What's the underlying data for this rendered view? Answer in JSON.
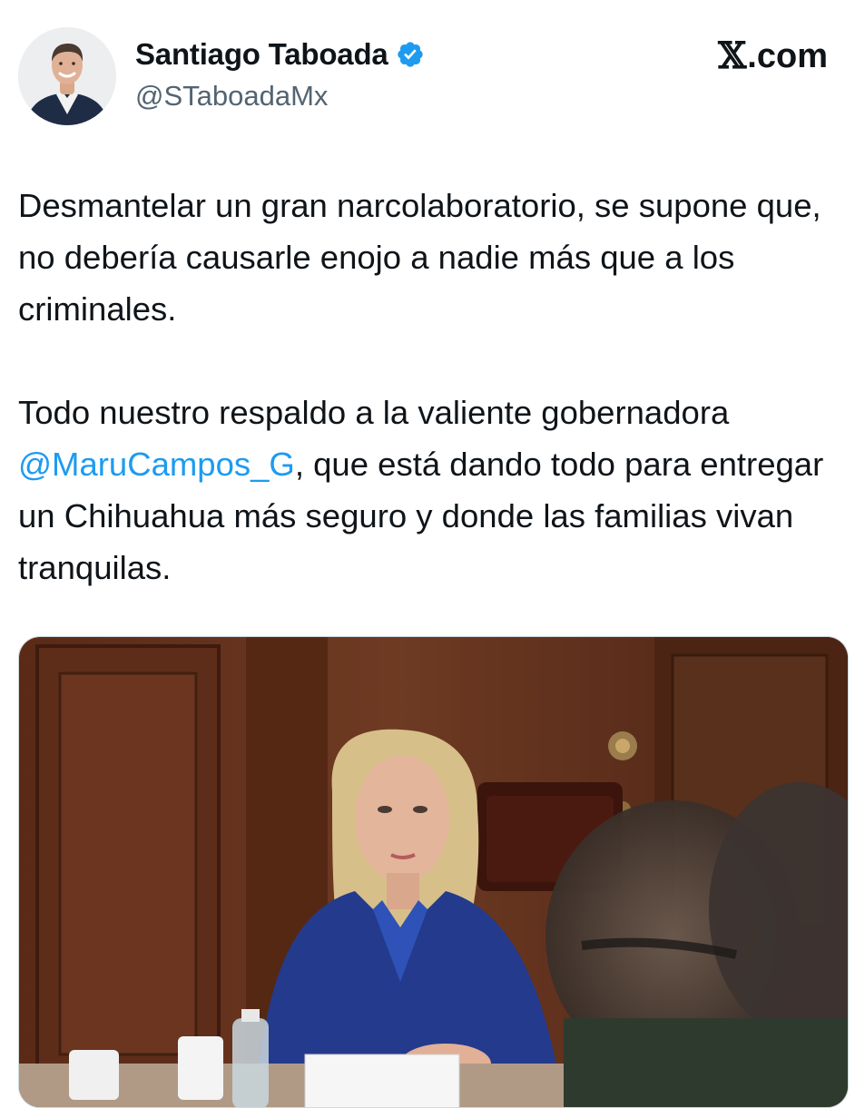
{
  "author": {
    "display_name": "Santiago Taboada",
    "handle": "@STaboadaMx",
    "verified": true,
    "avatar_icon": "avatar-photo-man-in-suit"
  },
  "brand": {
    "mark": "𝕏",
    "suffix": ".com"
  },
  "tweet": {
    "paragraph1": "Desmantelar un gran narcolaboratorio, se supone que, no debería causarle enojo a nadie más que a los criminales.",
    "paragraph2_before": "Todo nuestro respaldo a la valiente gobernadora ",
    "paragraph2_mention": "@MaruCampos_G",
    "paragraph2_after": ", que está dando todo para entregar un Chihuahua más seguro y donde las familias vivan tranquilas."
  },
  "media": {
    "description_icon": "photo-woman-at-meeting-table"
  },
  "colors": {
    "mention": "#1d9bf0",
    "verified": "#1d9bf0",
    "handle": "#536471",
    "text": "#0f1419"
  }
}
